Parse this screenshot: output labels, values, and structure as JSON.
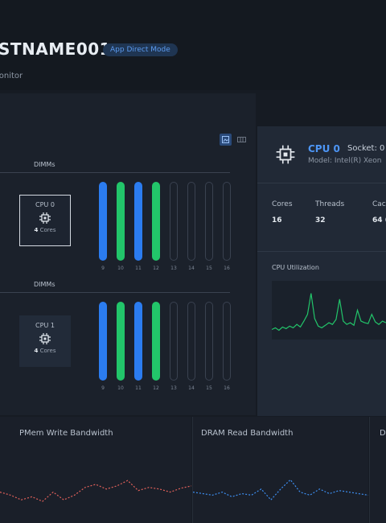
{
  "header": {
    "hostname": "STNAME001",
    "mode_badge": "App Direct Mode",
    "subtitle": "lonitor"
  },
  "topology": {
    "groups": [
      {
        "dimms_label": "DIMMs",
        "cpu_name": "CPU 0",
        "cpu_cores_count": "4",
        "cpu_cores_unit": "Cores",
        "selected": true,
        "dimms": [
          {
            "slot": "9",
            "status": "blue"
          },
          {
            "slot": "10",
            "status": "green"
          },
          {
            "slot": "11",
            "status": "blue"
          },
          {
            "slot": "12",
            "status": "green"
          },
          {
            "slot": "13",
            "status": "empty"
          },
          {
            "slot": "14",
            "status": "empty"
          },
          {
            "slot": "15",
            "status": "empty"
          },
          {
            "slot": "16",
            "status": "empty"
          }
        ]
      },
      {
        "dimms_label": "DIMMs",
        "cpu_name": "CPU 1",
        "cpu_cores_count": "4",
        "cpu_cores_unit": "Cores",
        "selected": false,
        "dimms": [
          {
            "slot": "9",
            "status": "blue"
          },
          {
            "slot": "10",
            "status": "green"
          },
          {
            "slot": "11",
            "status": "blue"
          },
          {
            "slot": "12",
            "status": "green"
          },
          {
            "slot": "13",
            "status": "empty"
          },
          {
            "slot": "14",
            "status": "empty"
          },
          {
            "slot": "15",
            "status": "empty"
          },
          {
            "slot": "16",
            "status": "empty"
          }
        ]
      }
    ]
  },
  "detail": {
    "cpu_title": "CPU 0",
    "socket": "Socket: 0",
    "model": "Model: Intel(R) Xeon",
    "stats": [
      {
        "label": "Cores",
        "value": "16"
      },
      {
        "label": "Threads",
        "value": "32"
      },
      {
        "label": "Cac",
        "value": "64 ("
      }
    ],
    "utilization_title": "CPU Utilization",
    "utilization_series": [
      12,
      14,
      11,
      15,
      13,
      16,
      14,
      18,
      15,
      22,
      30,
      55,
      25,
      16,
      14,
      17,
      20,
      18,
      24,
      48,
      22,
      18,
      20,
      17,
      35,
      22,
      20,
      19,
      30,
      21,
      18,
      22,
      20
    ]
  },
  "bandwidth": [
    {
      "title": "PMem Write Bandwidth",
      "series": [
        40,
        36,
        30,
        34,
        28,
        40,
        30,
        36,
        46,
        50,
        44,
        48,
        55,
        42,
        46,
        44,
        40,
        45,
        48
      ]
    },
    {
      "title": "DRAM Read Bandwidth",
      "series": [
        40,
        38,
        36,
        40,
        34,
        38,
        36,
        44,
        30,
        44,
        56,
        40,
        36,
        44,
        38,
        42,
        40,
        38,
        36
      ]
    },
    {
      "title": "D",
      "series": []
    }
  ],
  "colors": {
    "accent_blue": "#2b7cf0",
    "accent_green": "#22c56a",
    "write_line": "#e0605a",
    "read_line": "#3d8ef0",
    "util_line": "#22c56a"
  },
  "icons": {
    "cpu": "cpu-chip-icon",
    "view_grid": "grid-view-icon",
    "view_list": "list-view-icon"
  }
}
